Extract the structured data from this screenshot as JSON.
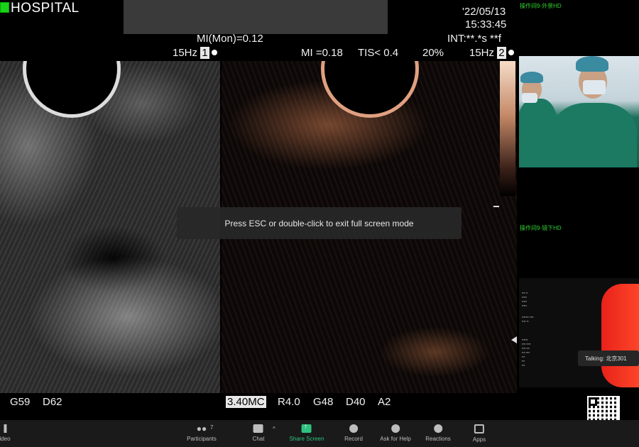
{
  "ultrasound": {
    "hospital": "HOSPITAL",
    "date": "'22/05/13",
    "time": "15:33:45",
    "mi_mon": "MI(Mon)=0.12",
    "int": "INT:**.*s **f",
    "left_hz": "15Hz",
    "left_index": "1",
    "mi": "MI =0.18",
    "tis": "TIS< 0.4",
    "percent": "20%",
    "right_hz": "15Hz",
    "right_index": "2",
    "bottom_left": [
      "G59",
      "D62"
    ],
    "freq": "3.40MC",
    "bottom_right": [
      "R4.0",
      "G48",
      "D40",
      "A2"
    ]
  },
  "toast": "Press ESC or double-click to exit full screen mode",
  "side_panel": {
    "label1": "操作间9-外景HD",
    "label2": "操作间9-镜下HD",
    "talking": "Talking: 北京301"
  },
  "toolbar": {
    "items": [
      {
        "label": "ideo",
        "icon": "video-icon"
      },
      {
        "label": "Participants",
        "icon": "participants-icon",
        "count": "7"
      },
      {
        "label": "Chat",
        "icon": "chat-icon"
      },
      {
        "label": "Share Screen",
        "icon": "share-screen-icon"
      },
      {
        "label": "Record",
        "icon": "record-icon"
      },
      {
        "label": "Ask for Help",
        "icon": "help-icon"
      },
      {
        "label": "Reactions",
        "icon": "reactions-icon"
      },
      {
        "label": "Apps",
        "icon": "apps-icon"
      }
    ]
  },
  "colors": {
    "share_accent": "#2ec27e",
    "status_green": "#31d431",
    "talking_bg": "#262626"
  }
}
